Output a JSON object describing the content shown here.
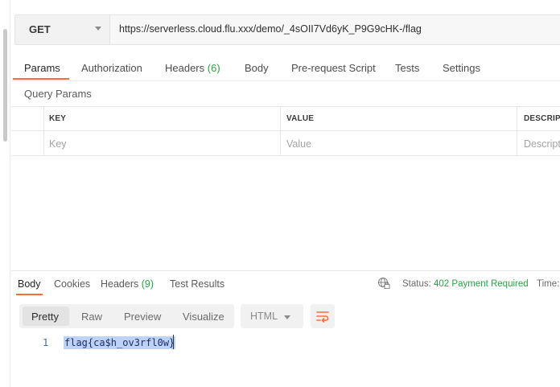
{
  "request": {
    "method": "GET",
    "url": "https://serverless.cloud.flu.xxx/demo/_4sOII7Vd6yK_P9G9cHK-/flag"
  },
  "request_tabs": {
    "params": "Params",
    "authorization": "Authorization",
    "headers": "Headers",
    "headers_count": "(6)",
    "body": "Body",
    "prerequest": "Pre-request Script",
    "tests": "Tests",
    "settings": "Settings"
  },
  "query_params": {
    "title": "Query Params",
    "headers": {
      "key": "KEY",
      "value": "VALUE",
      "description": "DESCRIPT"
    },
    "placeholders": {
      "key": "Key",
      "value": "Value",
      "description": "Descript"
    }
  },
  "response_tabs": {
    "body": "Body",
    "cookies": "Cookies",
    "headers": "Headers",
    "headers_count": "(9)",
    "test_results": "Test Results"
  },
  "status": {
    "label": "Status:",
    "value": "402 Payment Required",
    "time_label": "Time:"
  },
  "view_modes": {
    "pretty": "Pretty",
    "raw": "Raw",
    "preview": "Preview",
    "visualize": "Visualize",
    "format": "HTML"
  },
  "response_body": {
    "line_number": "1",
    "content": "flag{ca$h_ov3rfl0w}"
  },
  "icons": {
    "globe": "globe-icon",
    "wrap": "wrap-lines-icon",
    "dropdown": "chevron-down-icon"
  },
  "colors": {
    "accent": "#ff6c37",
    "success": "#26a541",
    "selection": "#bcd3f5"
  }
}
